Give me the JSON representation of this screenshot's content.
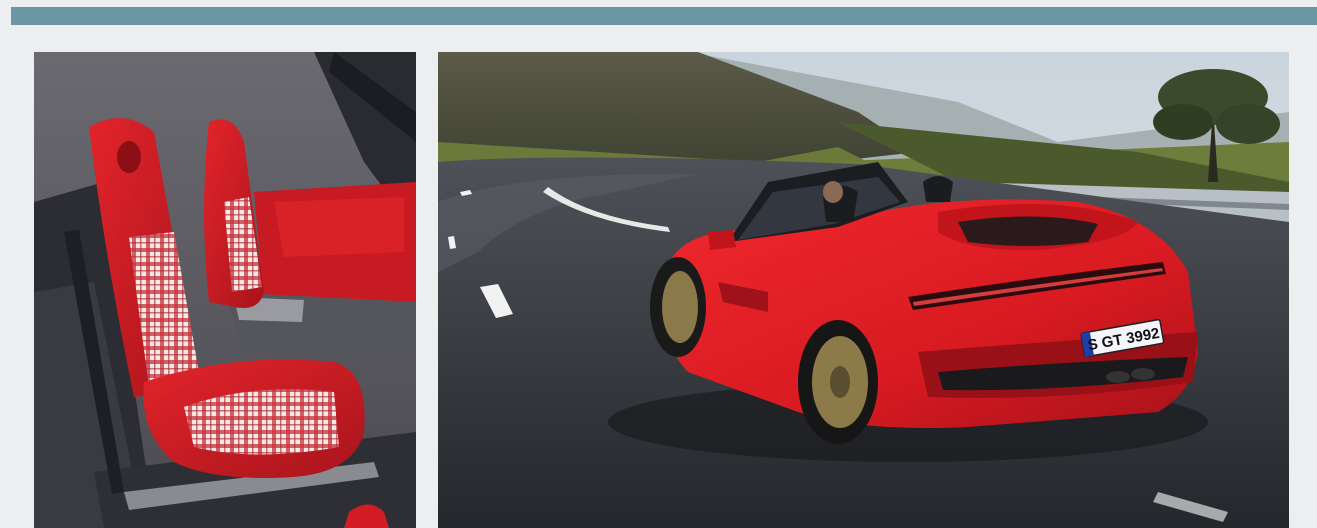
{
  "header": {
    "bar_color": "#6a97a3"
  },
  "page": {
    "background": "#eceef0"
  },
  "photos": [
    {
      "subject": "interior-red-plaid-seats"
    },
    {
      "subject": "red-convertible-on-coastal-road"
    }
  ],
  "car": {
    "license_plate": "S GT 3992",
    "body_color": "#e01b22"
  }
}
